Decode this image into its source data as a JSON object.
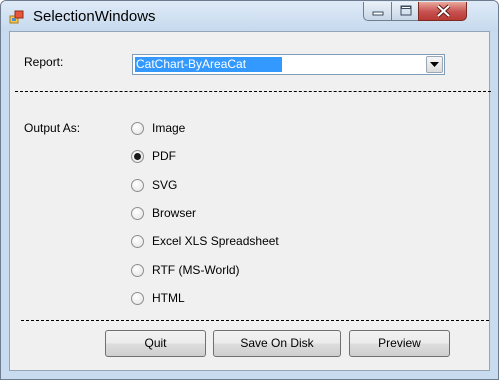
{
  "window": {
    "title": "SelectionWindows",
    "icon": "app-window-icon"
  },
  "caption_buttons": {
    "minimize_icon": "minimize-icon",
    "maximize_icon": "maximize-icon",
    "close_icon": "close-icon"
  },
  "report": {
    "label": "Report:",
    "selected": "CatChart-ByAreaCat"
  },
  "output": {
    "label": "Output As:",
    "options": [
      {
        "label": "Image",
        "checked": false
      },
      {
        "label": "PDF",
        "checked": true
      },
      {
        "label": "SVG",
        "checked": false
      },
      {
        "label": "Browser",
        "checked": false
      },
      {
        "label": "Excel XLS Spreadsheet",
        "checked": false
      },
      {
        "label": "RTF (MS-World)",
        "checked": false
      },
      {
        "label": "HTML",
        "checked": false
      }
    ]
  },
  "buttons": {
    "quit": "Quit",
    "save": "Save On Disk",
    "preview": "Preview"
  },
  "colors": {
    "selection": "#3399ff",
    "frame": "#c9dcef",
    "client": "#f0f0f0",
    "close_button": "#c75050"
  }
}
